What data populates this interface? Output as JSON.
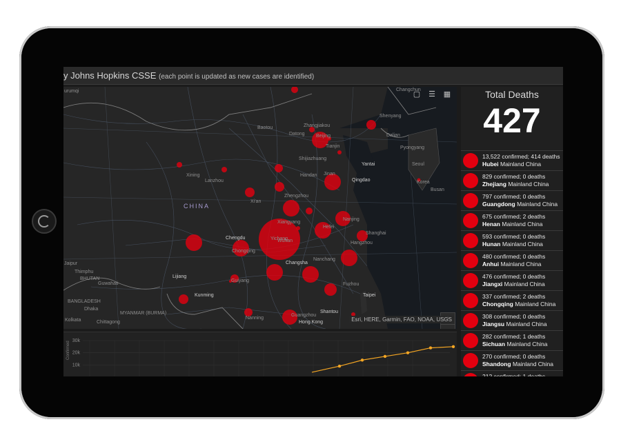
{
  "title": {
    "main": "y Johns Hopkins CSSE",
    "sub": "(each point is updated as new cases are identified)"
  },
  "map": {
    "country_label": "CHINA",
    "labels": [
      "Changchun",
      "Shenyang",
      "Baotou",
      "Zhangjiakou",
      "Beijing",
      "Datong",
      "Tianjin",
      "Dalian",
      "Pyongyang",
      "Seoul",
      "Korea",
      "Busan",
      "Yantai",
      "Qingdao",
      "Shijiazhuang",
      "Handan",
      "Jinan",
      "Xining",
      "Lanzhou",
      "Zhengzhou",
      "Xi'an",
      "Xiangyang",
      "Chengdu",
      "Yichang",
      "Chongqing",
      "Hefei",
      "Nanjing",
      "Wuhan",
      "Shanghai",
      "Hangzhou",
      "Nanchang",
      "Changsha",
      "Fuzhou",
      "Taipei",
      "Lijiang",
      "Kunming",
      "Guiyang",
      "Guangzhou",
      "Shantou",
      "Hong Kong",
      "Nanning",
      "Thimphu",
      "BHUTAN",
      "Guwahati",
      "BANGLADESH",
      "Dhaka",
      "Kolkata",
      "Chittagong",
      "MYANMAR (BURMA)",
      "Jaipur",
      "urumqi"
    ],
    "zoom_in": "+",
    "zoom_out": "−",
    "attribution": "Esri, HERE, Garmin, FAO, NOAA, USGS",
    "tool_icons": [
      "bookmark-icon",
      "list-icon",
      "qr-icon"
    ],
    "bubble_color": "#e3000f"
  },
  "chart": {
    "y_ticks": [
      "30k",
      "20k",
      "10k"
    ],
    "line_color": "#f5a623"
  },
  "chart_data": {
    "type": "line",
    "x": [
      1,
      2,
      3,
      4,
      5,
      6
    ],
    "y": [
      9000,
      14000,
      17000,
      20000,
      24000,
      25000
    ],
    "ylim": [
      0,
      30000
    ],
    "yticks": [
      "30k",
      "20k",
      "10k"
    ]
  },
  "side": {
    "label": "Total Deaths",
    "value": "427",
    "items": [
      {
        "confirmed": "13,522 confirmed;",
        "deaths": "414 deaths",
        "province": "Hubei",
        "region": "Mainland China"
      },
      {
        "confirmed": "829 confirmed;",
        "deaths": "0 deaths",
        "province": "Zhejiang",
        "region": "Mainland China"
      },
      {
        "confirmed": "797 confirmed;",
        "deaths": "0 deaths",
        "province": "Guangdong",
        "region": "Mainland China"
      },
      {
        "confirmed": "675 confirmed;",
        "deaths": "2 deaths",
        "province": "Henan",
        "region": "Mainland China"
      },
      {
        "confirmed": "593 confirmed;",
        "deaths": "0 deaths",
        "province": "Hunan",
        "region": "Mainland China"
      },
      {
        "confirmed": "480 confirmed;",
        "deaths": "0 deaths",
        "province": "Anhui",
        "region": "Mainland China"
      },
      {
        "confirmed": "476 confirmed;",
        "deaths": "0 deaths",
        "province": "Jiangxi",
        "region": "Mainland China"
      },
      {
        "confirmed": "337 confirmed;",
        "deaths": "2 deaths",
        "province": "Chongqing",
        "region": "Mainland China"
      },
      {
        "confirmed": "308 confirmed;",
        "deaths": "0 deaths",
        "province": "Jiangsu",
        "region": "Mainland China"
      },
      {
        "confirmed": "282 confirmed;",
        "deaths": "1 deaths",
        "province": "Sichuan",
        "region": "Mainland China"
      },
      {
        "confirmed": "270 confirmed;",
        "deaths": "0 deaths",
        "province": "Shandong",
        "region": "Mainland China"
      },
      {
        "confirmed": "212 confirmed;",
        "deaths": "1 deaths",
        "province": "",
        "region": ""
      }
    ]
  }
}
